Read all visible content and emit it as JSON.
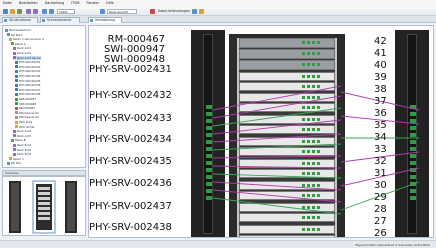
{
  "menu": [
    "Datei",
    "Bearbeiten",
    "Darstellung",
    "ITSM",
    "Fenster",
    "Hilfe"
  ],
  "toolbar": {
    "zoom_value": "100%",
    "view_select": "Rack-Ansicht",
    "label": "Kabel-Verbindungen"
  },
  "tabs": [
    {
      "label": "Strukturbaum"
    },
    {
      "label": "Schrankansicht"
    },
    {
      "label": "Verkabelung"
    }
  ],
  "tree": {
    "items": [
      "Rechenzentrum",
      "RZ Nord",
      "Raum 1 Serverraum A",
      "Reihe A",
      "Rack A-01",
      "Rack A-02",
      "Rack A-03 Server",
      "PHY-SRV-00431",
      "PHY-SRV-00432",
      "PHY-SRV-00433",
      "PHY-SRV-00434",
      "PHY-SRV-00435",
      "PHY-SRV-00436",
      "PHY-SRV-00437",
      "PHY-SRV-00438",
      "SWI-000947",
      "SWI-000948",
      "RM-000467",
      "Patchpanel 01",
      "Patchpanel 02",
      "PDU links",
      "PDU rechts",
      "Rack A-04",
      "Rack A-05",
      "Reihe B",
      "Rack B-01",
      "Rack B-02",
      "Rack B-03",
      "Raum 2",
      "RZ Süd"
    ]
  },
  "preview_title": "Vorschau",
  "canvas": {
    "device_labels": [
      "RM-000467",
      "SWI-000947",
      "SWI-000948",
      "PHY-SRV-002431",
      "PHY-SRV-002432",
      "PHY-SRV-002433",
      "PHY-SRV-002434",
      "PHY-SRV-002435",
      "PHY-SRV-002436",
      "PHY-SRV-002437",
      "PHY-SRV-002438"
    ],
    "unit_numbers": [
      "42",
      "41",
      "40",
      "39",
      "38",
      "37",
      "36",
      "35",
      "34",
      "33",
      "32",
      "31",
      "30",
      "29",
      "28",
      "27",
      "26"
    ]
  },
  "status_text": "Eigenschaften aktualisiert 4 Sekunden (Infra-RIM)",
  "colors": {
    "wire_purple": "#b03ab0",
    "wire_green": "#3aa655",
    "selection": "#c8dcf4"
  }
}
